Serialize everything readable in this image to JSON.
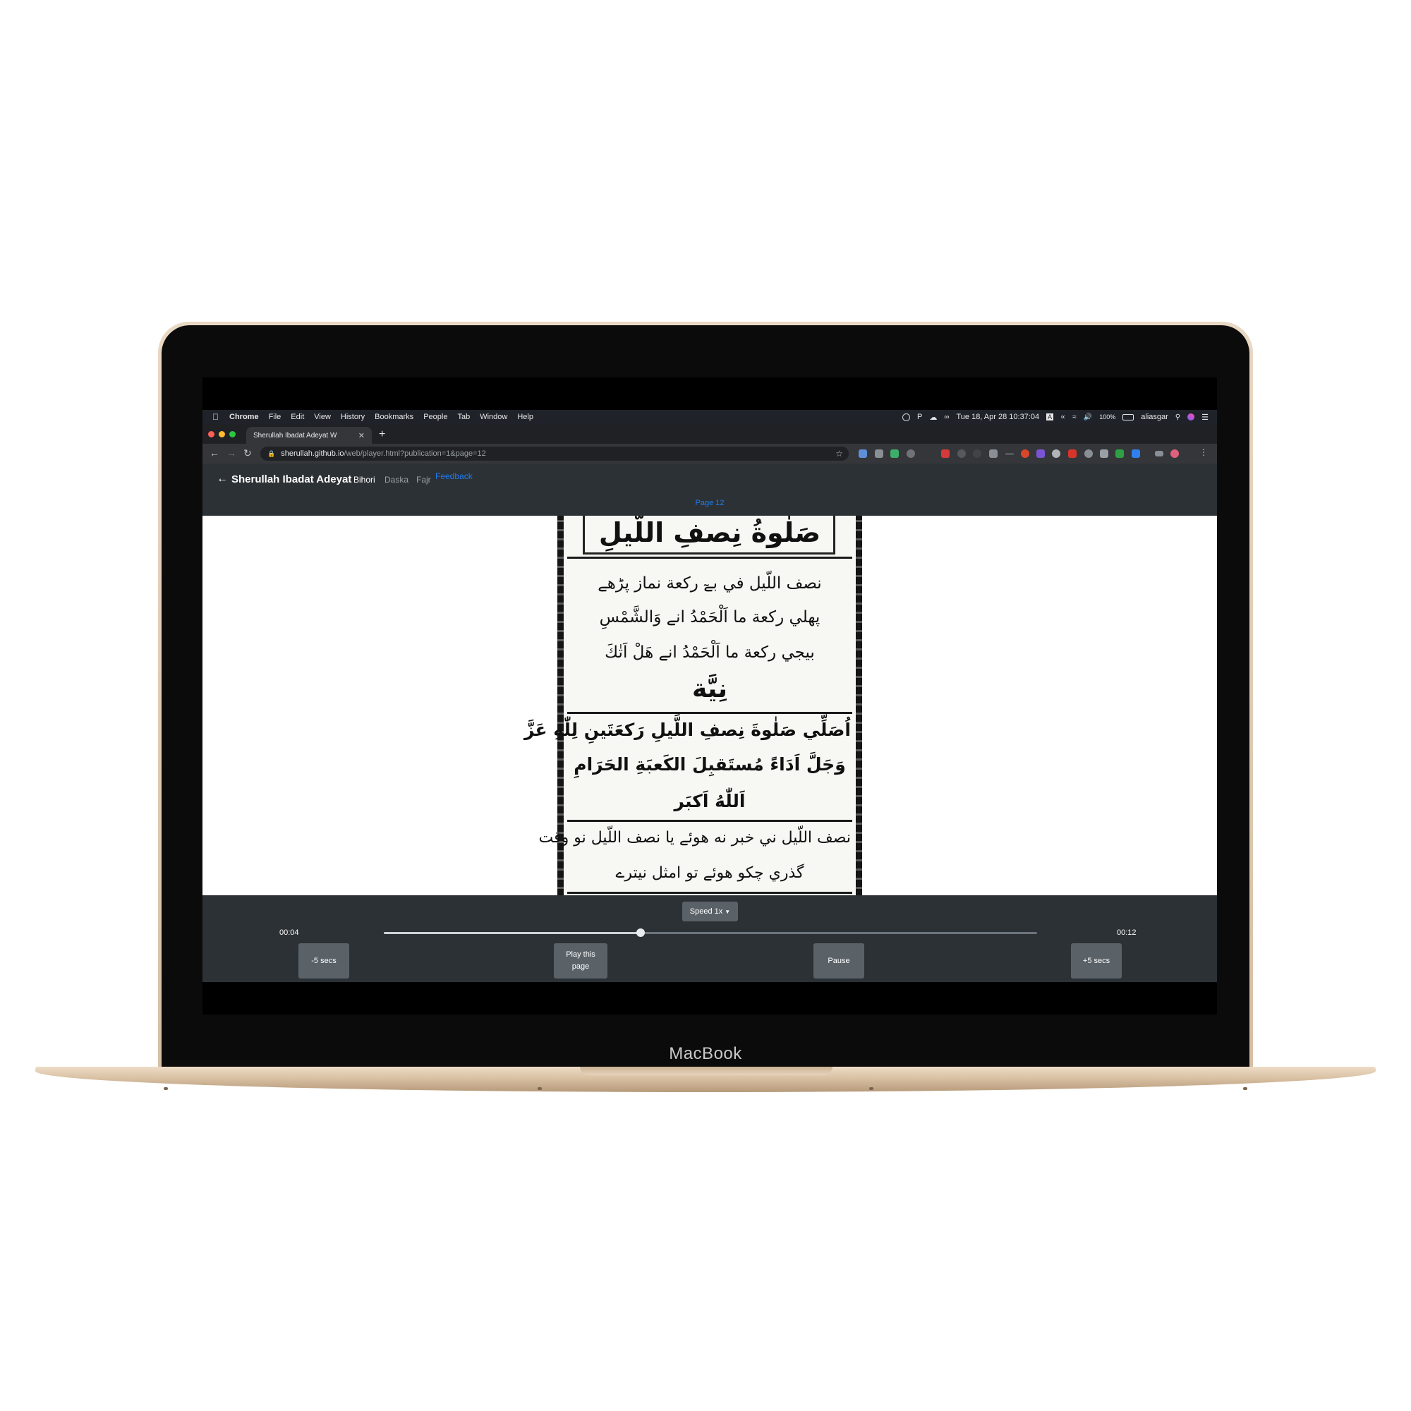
{
  "device": {
    "brand_label": "MacBook"
  },
  "menubar": {
    "app": "Chrome",
    "menus": [
      "File",
      "Edit",
      "View",
      "History",
      "Bookmarks",
      "People",
      "Tab",
      "Window",
      "Help"
    ],
    "clock": "Tue 18, Apr 28  10:37:04",
    "battery": "100%",
    "user": "aliasgar"
  },
  "browser": {
    "tab_title": "Sherullah Ibadat Adeyat W",
    "url_host": "sherullah.github.io",
    "url_path": "/web/player.html?publication=1&page=12"
  },
  "app": {
    "title": "Sherullah Ibadat Adeyat",
    "nav": [
      "Bihori",
      "Daska",
      "Fajr"
    ],
    "feedback": "Feedback",
    "page_label": "Page 12"
  },
  "document": {
    "heading": "صَلٰوةُ نِصفِ اللَّيلِ",
    "lines": [
      "نصف اللّيل في بےٓ ركعة نماز پڑھے",
      "پهلي ركعة ما   اَلْحَمْدُ انے وَالشَّمْسِ",
      "بيجي ركعة ما   اَلْحَمْدُ انے هَلْ اَتٰكَ",
      "نِيَّة",
      "اُصَلِّي صَلٰوةَ نِصفِ اللَّيلِ رَكعَتَينِ لِلّٰهِ عَزَّ",
      "وَجَلَّ اَدَاءً مُستَقبِلَ الكَعبَةِ الحَرَامِ",
      "اَللّٰهُ اَكبَر",
      "نصف اللّيل ني خبر نه هوئے يا نصف اللّيل نو وقت",
      "گذري چكو هوئے تو امثل نيترے"
    ]
  },
  "player": {
    "speed_label": "Speed 1x",
    "current_time": "00:04",
    "total_time": "00:12",
    "progress": 0.393,
    "buttons": {
      "back5": "-5 secs",
      "play_page": "Play this page",
      "pause": "Pause",
      "fwd5": "+5 secs"
    }
  },
  "colors": {
    "header_bg": "#2c3136",
    "link_accent": "#1f7cf0",
    "button_bg": "#5a6268",
    "frame_gold": "#e3cdb2"
  }
}
